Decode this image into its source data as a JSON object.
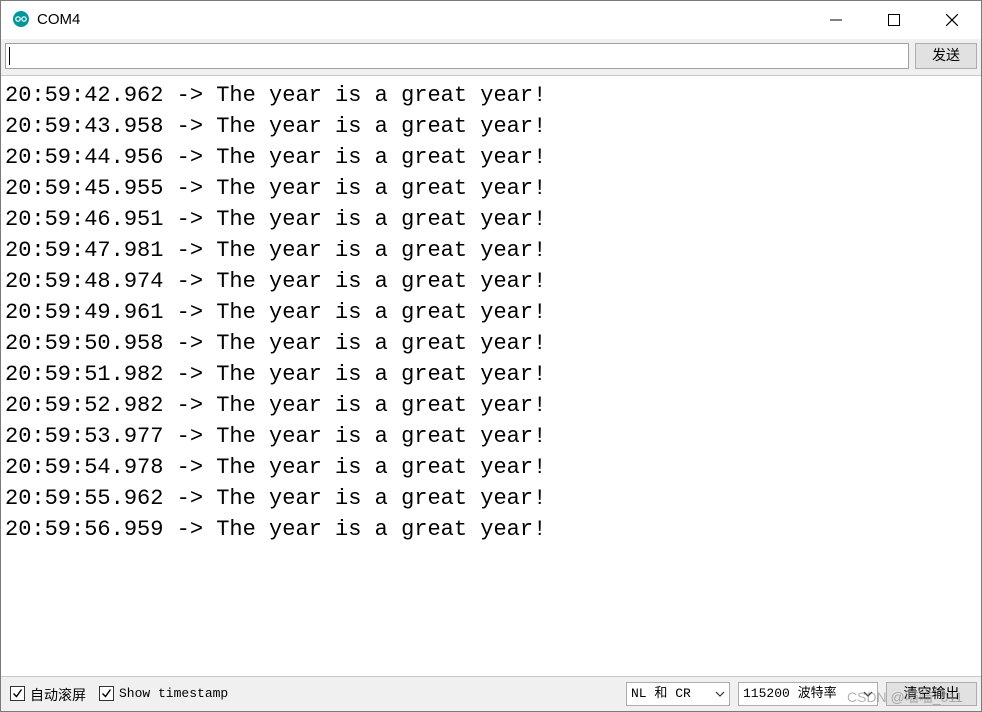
{
  "window": {
    "title": "COM4",
    "app_icon": "arduino-icon",
    "controls": [
      "minimize-icon",
      "maximize-icon",
      "close-icon"
    ]
  },
  "input_row": {
    "input_value": "",
    "send_label": "发送"
  },
  "output": {
    "lines": [
      "20:59:42.962 -> The year is a great year!",
      "20:59:43.958 -> The year is a great year!",
      "20:59:44.956 -> The year is a great year!",
      "20:59:45.955 -> The year is a great year!",
      "20:59:46.951 -> The year is a great year!",
      "20:59:47.981 -> The year is a great year!",
      "20:59:48.974 -> The year is a great year!",
      "20:59:49.961 -> The year is a great year!",
      "20:59:50.958 -> The year is a great year!",
      "20:59:51.982 -> The year is a great year!",
      "20:59:52.982 -> The year is a great year!",
      "20:59:53.977 -> The year is a great year!",
      "20:59:54.978 -> The year is a great year!",
      "20:59:55.962 -> The year is a great year!",
      "20:59:56.959 -> The year is a great year!"
    ]
  },
  "statusbar": {
    "autoscroll_label": "自动滚屏",
    "autoscroll_checked": true,
    "timestamp_label": "Show timestamp",
    "timestamp_checked": true,
    "line_ending": "NL 和 CR",
    "baud_rate": "115200 波特率",
    "clear_label": "清空输出"
  },
  "watermark": "CSDN @喵喵_011",
  "colors": {
    "arduino_teal": "#00979c",
    "window_bg": "#f0f0f0",
    "button_bg": "#e1e1e1"
  }
}
